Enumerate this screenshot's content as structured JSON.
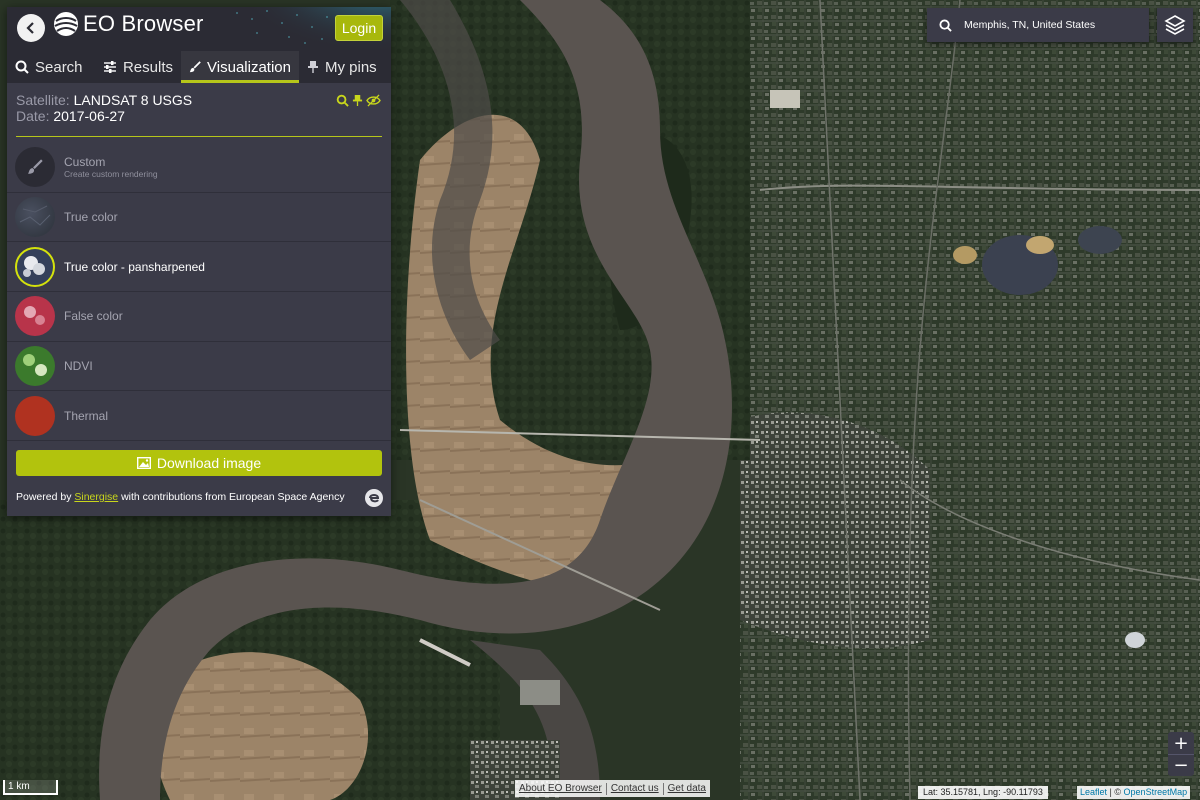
{
  "app": {
    "title": "EO Browser",
    "login_label": "Login"
  },
  "tabs": [
    {
      "label": "Search",
      "icon": "search-icon",
      "active": false
    },
    {
      "label": "Results",
      "icon": "sliders-icon",
      "active": false
    },
    {
      "label": "Visualization",
      "icon": "brush-icon",
      "active": true
    },
    {
      "label": "My pins",
      "icon": "pin-icon",
      "active": false
    }
  ],
  "info": {
    "satellite_label": "Satellite:",
    "satellite_value": "LANDSAT 8 USGS",
    "date_label": "Date:",
    "date_value": "2017-06-27"
  },
  "layers": [
    {
      "title": "Custom",
      "subtitle": "Create custom rendering",
      "icon": "brush-icon",
      "active": false
    },
    {
      "title": "True color",
      "subtitle": "",
      "icon": "true-color-thumb",
      "active": false
    },
    {
      "title": "True color - pansharpened",
      "subtitle": "",
      "icon": "pansharpened-thumb",
      "active": true
    },
    {
      "title": "False color",
      "subtitle": "",
      "icon": "false-color-thumb",
      "active": false
    },
    {
      "title": "NDVI",
      "subtitle": "",
      "icon": "ndvi-thumb",
      "active": false
    },
    {
      "title": "Thermal",
      "subtitle": "",
      "icon": "thermal-thumb",
      "active": false
    }
  ],
  "download_label": "Download image",
  "powered": {
    "prefix": "Powered by",
    "link": "Sinergise",
    "suffix": "with contributions from European Space Agency"
  },
  "search": {
    "value": "Memphis, TN, United States"
  },
  "zoom": {
    "in": "+",
    "out": "−"
  },
  "scale_label": "1 km",
  "footer_links": [
    "About EO Browser",
    "Contact us",
    "Get data"
  ],
  "coords_text": "Lat: 35.15781, Lng: -90.11793",
  "attribution": {
    "leaflet": "Leaflet",
    "separator": "| ©",
    "osm": "OpenStreetMap"
  },
  "colors": {
    "accent": "#b2c30d",
    "panel": "#3b3b48",
    "header": "#2b2b34"
  }
}
